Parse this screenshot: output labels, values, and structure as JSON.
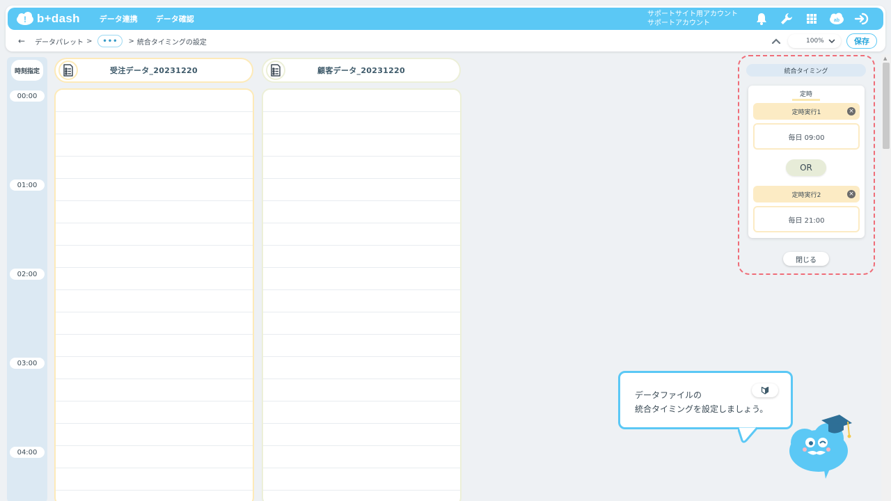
{
  "header": {
    "logo_text": "b+dash",
    "nav": [
      "データ連携",
      "データ確認"
    ],
    "account_line1": "サポートサイト用アカウント",
    "account_line2": "サポートアカウント",
    "icons": [
      "bell-icon",
      "wrench-icon",
      "apps-grid-icon",
      "notification-cloud-icon",
      "logout-icon"
    ]
  },
  "breadcrumb": {
    "back": "←",
    "root": "データパレット",
    "sep1": ">",
    "ellipsis": "•••",
    "sep2": ">",
    "current": "統合タイミングの設定"
  },
  "toolbar": {
    "zoom": "100%",
    "save_label": "保存"
  },
  "time_column": {
    "header": "時刻指定",
    "labels": [
      "00:00",
      "01:00",
      "02:00",
      "03:00",
      "04:00"
    ]
  },
  "files": [
    {
      "name": "受注データ_20231220",
      "color": "#fdeab8"
    },
    {
      "name": "顧客データ_20231220",
      "color": "#ecefd8"
    }
  ],
  "panel": {
    "title": "統合タイミング",
    "section_label": "定時",
    "schedules": [
      {
        "name": "定時実行1",
        "time": "毎日 09:00"
      },
      {
        "name": "定時実行2",
        "time": "毎日 21:00"
      }
    ],
    "or_label": "OR",
    "close_label": "閉じる"
  },
  "tip": {
    "line1": "データファイルの",
    "line2": "統合タイミングを設定しましょう。"
  },
  "colors": {
    "accent": "#5bc8f5",
    "highlight_frame": "#ef6d78",
    "schedule": "#fcebc4"
  }
}
